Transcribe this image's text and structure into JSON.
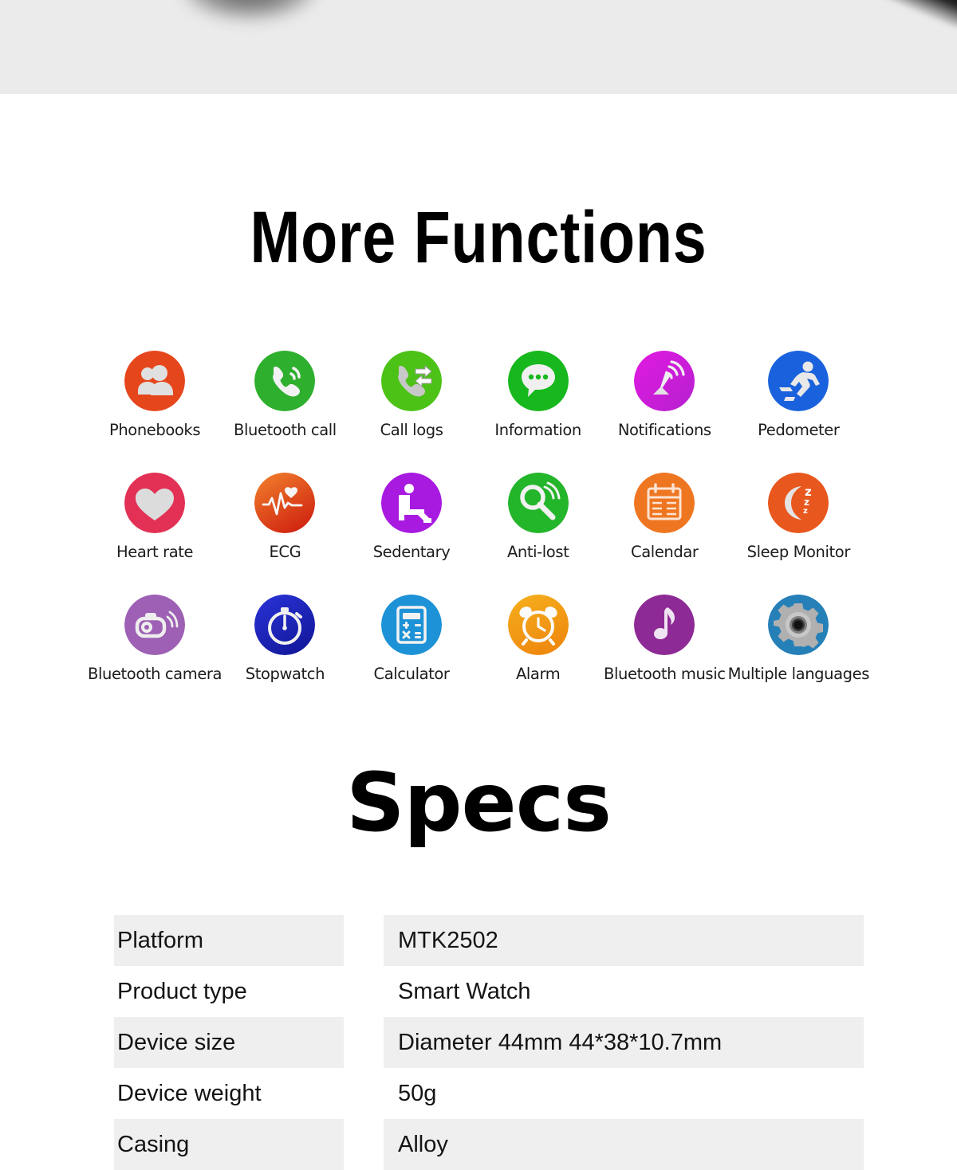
{
  "page": {
    "background_color": "#ffffff",
    "top_strip_color": "#ebebeb"
  },
  "sections": {
    "functions_title": "More Functions",
    "specs_title": "Specs"
  },
  "features": [
    {
      "label": "Phonebooks",
      "icon": "contacts-icon",
      "color": "#e6461c"
    },
    {
      "label": "Bluetooth call",
      "icon": "phone-call-icon",
      "color": "#2eaf2e"
    },
    {
      "label": "Call logs",
      "icon": "call-logs-icon",
      "color": "#4cc217"
    },
    {
      "label": "Information",
      "icon": "chat-bubble-icon",
      "color": "#17b81d"
    },
    {
      "label": "Notifications",
      "icon": "antenna-signal-icon",
      "color": "#d41ad4"
    },
    {
      "label": "Pedometer",
      "icon": "running-person-icon",
      "color": "#1a62dd"
    },
    {
      "label": "Heart rate",
      "icon": "heart-icon",
      "color": "#e23155"
    },
    {
      "label": "ECG",
      "icon": "ecg-waveform-icon",
      "color": "#e04718"
    },
    {
      "label": "Sedentary",
      "icon": "seated-person-icon",
      "color": "#a81ae0"
    },
    {
      "label": "Anti-lost",
      "icon": "magnifier-icon",
      "color": "#23b52a"
    },
    {
      "label": "Calendar",
      "icon": "calendar-icon",
      "color": "#ef7621"
    },
    {
      "label": "Sleep Monitor",
      "icon": "moon-zzz-icon",
      "color": "#e8571d"
    },
    {
      "label": "Bluetooth camera",
      "icon": "camera-icon",
      "color": "#9d60b4"
    },
    {
      "label": "Stopwatch",
      "icon": "stopwatch-icon",
      "color": "#2028c4"
    },
    {
      "label": "Calculator",
      "icon": "calculator-icon",
      "color": "#1e92d6"
    },
    {
      "label": "Alarm",
      "icon": "alarm-clock-icon",
      "color": "#f0a01c"
    },
    {
      "label": "Bluetooth music",
      "icon": "music-note-icon",
      "color": "#8e2a95"
    },
    {
      "label": "Multiple languages",
      "icon": "gear-icon",
      "color": "#2680b8"
    }
  ],
  "specs": {
    "rows": [
      {
        "key": "Platform",
        "value": "MTK2502",
        "shaded": true
      },
      {
        "key": "Product type",
        "value": "Smart Watch",
        "shaded": false
      },
      {
        "key": "Device size",
        "value": "Diameter 44mm  44*38*10.7mm",
        "shaded": true
      },
      {
        "key": "Device weight",
        "value": "50g",
        "shaded": false
      },
      {
        "key": "Casing",
        "value": "Alloy",
        "shaded": true
      }
    ]
  }
}
